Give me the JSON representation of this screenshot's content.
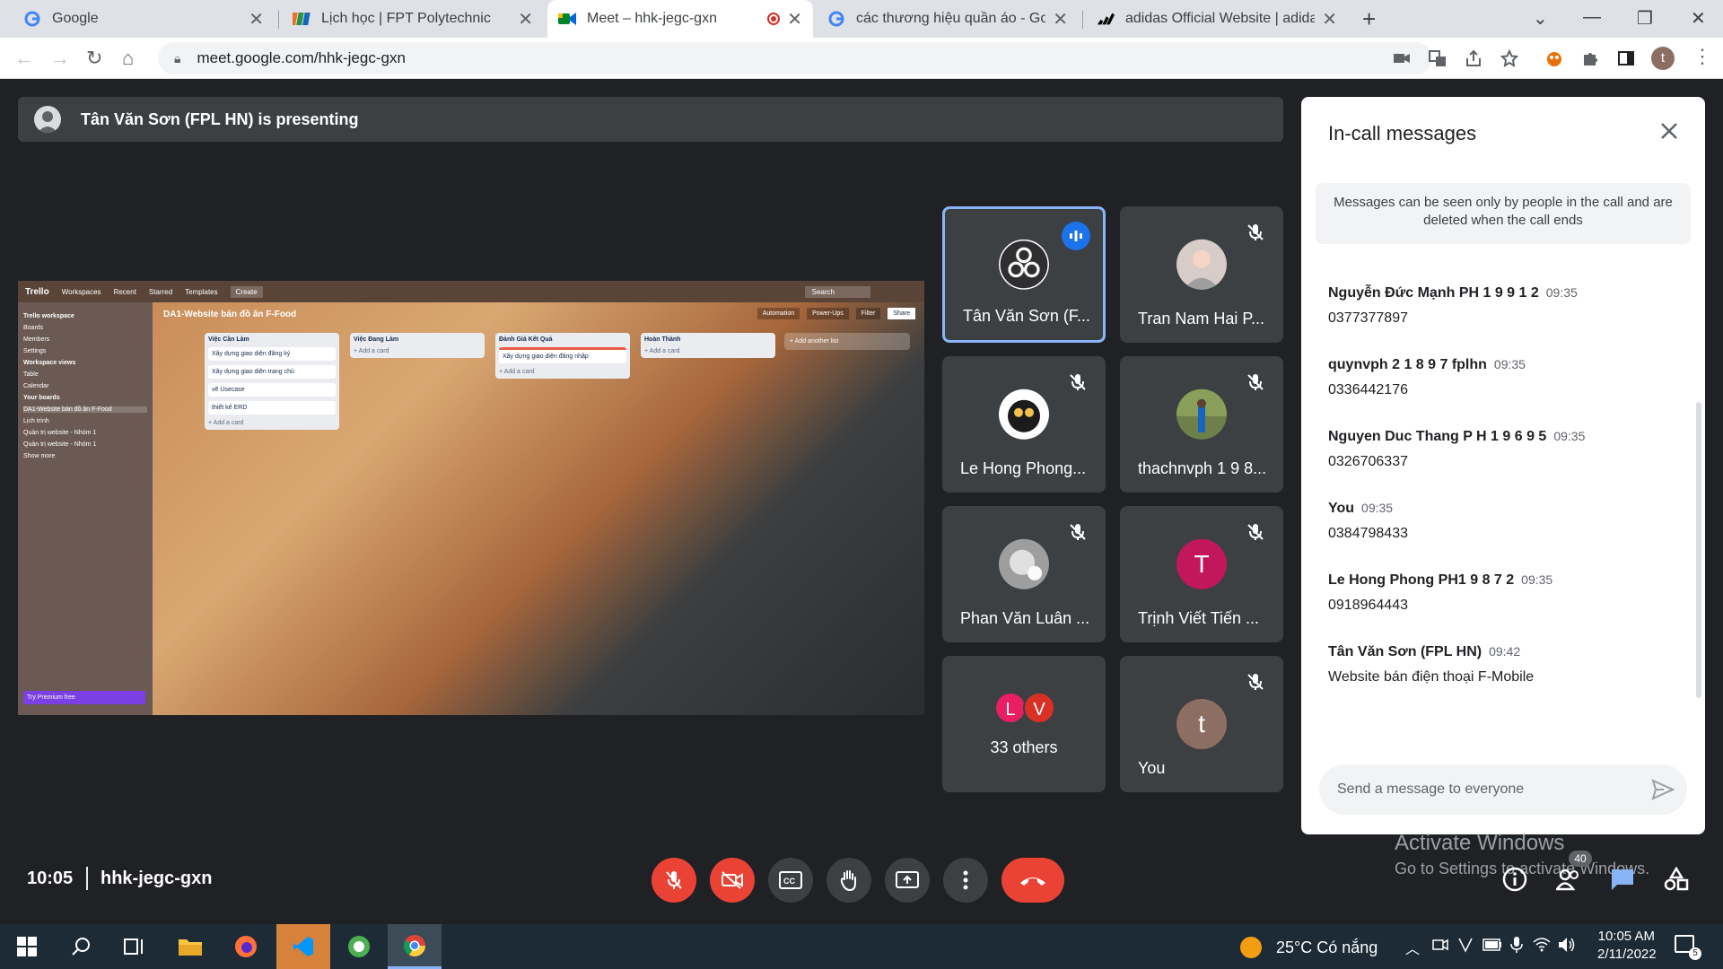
{
  "browser": {
    "tabs": [
      {
        "title": "Google",
        "active": false
      },
      {
        "title": "Lịch học | FPT Polytechnic",
        "active": false
      },
      {
        "title": "Meet – hhk-jegc-gxn",
        "active": true
      },
      {
        "title": "các thương hiệu quần áo - Goog",
        "active": false
      },
      {
        "title": "adidas Official Website | adidas U",
        "active": false
      }
    ],
    "url": "meet.google.com/hhk-jegc-gxn",
    "profile_initial": "t"
  },
  "meet": {
    "presenting_banner": "Tân Văn Sơn (FPL HN) is presenting",
    "shared_screen": {
      "app": "Trello",
      "menu": [
        "Workspaces",
        "Recent",
        "Starred",
        "Templates",
        "Create"
      ],
      "board_title": "DA1-Website bán đồ ăn F-Food",
      "workspace": "Trello workspace",
      "sidebar_items": [
        "Boards",
        "Members",
        "Settings",
        "Workspace views",
        "Table",
        "Calendar",
        "Your boards",
        "DA1-Website bán đồ ăn F-Food",
        "Lịch trình",
        "Quản trị website - Nhóm 1",
        "Quản trị website - Nhóm 1",
        "Show more"
      ],
      "premium": "Try Premium free",
      "lists": [
        {
          "title": "Việc Cần Làm",
          "cards": [
            "Xây dựng giao diện đăng ký",
            "Xây dựng giao diện trang chủ",
            "vẽ Usecase",
            "thiết kế ERD"
          ],
          "add": "+ Add a card"
        },
        {
          "title": "Việc Đang Làm",
          "cards": [],
          "add": "+ Add a card"
        },
        {
          "title": "Đánh Giá Kết Quả",
          "cards": [
            "Xây dựng giao diện đăng nhập"
          ],
          "add": "+ Add a card"
        },
        {
          "title": "Hoàn Thành",
          "cards": [],
          "add": "+ Add a card"
        }
      ],
      "add_list": "+ Add another list",
      "board_buttons": [
        "Automation",
        "Power-Ups",
        "Filter",
        "Share"
      ],
      "search": "Search"
    },
    "participants": [
      {
        "name": "Tân Văn Sơn (F...",
        "speaking": true,
        "muted": false,
        "avatar": "obs-logo"
      },
      {
        "name": "Tran Nam Hai P...",
        "speaking": false,
        "muted": true,
        "avatar": "photo"
      },
      {
        "name": "Le Hong Phong...",
        "speaking": false,
        "muted": true,
        "avatar": "photo"
      },
      {
        "name": "thachnvph 1 9 8...",
        "speaking": false,
        "muted": true,
        "avatar": "photo"
      },
      {
        "name": "Phan Văn Luân ...",
        "speaking": false,
        "muted": true,
        "avatar": "photo"
      },
      {
        "name": "Trịnh Viết Tiến ...",
        "speaking": false,
        "muted": true,
        "avatar": "T",
        "avatar_color": "#c2185b"
      },
      {
        "name": "33 others",
        "others_avatars": [
          "L",
          "V"
        ],
        "others_colors": [
          "#e91e63",
          "#d93025"
        ]
      },
      {
        "name": "You",
        "muted": true,
        "avatar": "t",
        "avatar_color": "#8d6e63"
      }
    ],
    "chat": {
      "title": "In-call messages",
      "notice": "Messages can be seen only by people in the call and are deleted when the call ends",
      "messages": [
        {
          "sender": "Nguyễn Đức Mạnh PH 1 9 9 1 2",
          "time": "09:35",
          "text": "0377377897"
        },
        {
          "sender": "quynvph 2 1 8 9 7 fplhn",
          "time": "09:35",
          "text": "0336442176"
        },
        {
          "sender": "Nguyen Duc Thang P H 1 9 6 9 5",
          "time": "09:35",
          "text": "0326706337"
        },
        {
          "sender": "You",
          "time": "09:35",
          "text": "0384798433"
        },
        {
          "sender": "Le Hong Phong PH1 9 8 7 2",
          "time": "09:35",
          "text": "0918964443"
        },
        {
          "sender": "Tân Văn Sơn (FPL HN)",
          "time": "09:42",
          "text": "Website bán điện thoại F-Mobile"
        }
      ],
      "placeholder": "Send a message to everyone"
    },
    "clock": "10:05",
    "meeting_code": "hhk-jegc-gxn",
    "participant_count": "40",
    "watermark": {
      "line1": "Activate Windows",
      "line2": "Go to Settings to activate Windows."
    }
  },
  "taskbar": {
    "weather": "25°C Có nắng",
    "time": "10:05 AM",
    "date": "2/11/2022",
    "notifications": "5"
  },
  "colors": {
    "accent": "#1a73e8",
    "danger": "#ea4335",
    "surface": "#3c4043",
    "background": "#202124"
  }
}
